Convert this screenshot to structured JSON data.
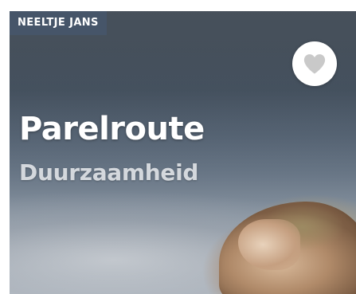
{
  "card": {
    "location_tag": "NEELTJE JANS",
    "title": "Parelroute",
    "subtitle": "Duurzaamheid",
    "favorite_icon": "heart-icon"
  },
  "colors": {
    "tag_background": "#46566a",
    "title_text": "#ffffff",
    "subtitle_text": "#d4d8dd",
    "favorite_button": "#ffffff",
    "heart": "#c9c9c9"
  }
}
